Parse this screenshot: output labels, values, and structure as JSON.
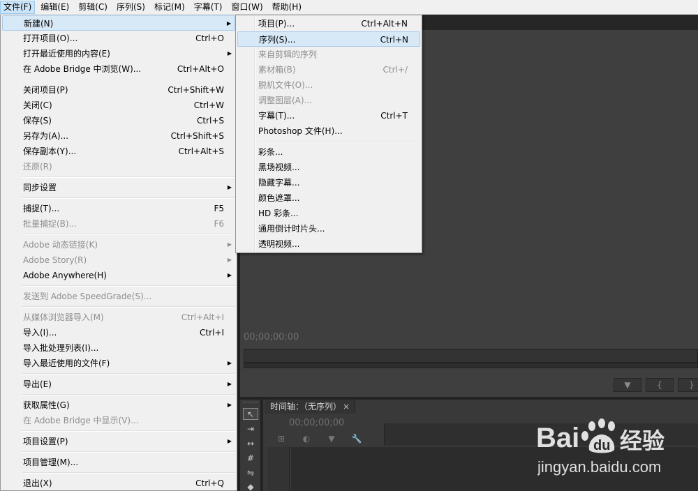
{
  "menubar": {
    "items": [
      "文件(F)",
      "编辑(E)",
      "剪辑(C)",
      "序列(S)",
      "标记(M)",
      "字幕(T)",
      "窗口(W)",
      "帮助(H)"
    ]
  },
  "file_menu": {
    "items": [
      {
        "label": "新建(N)",
        "shortcut": "",
        "submenu": true
      },
      {
        "label": "打开项目(O)...",
        "shortcut": "Ctrl+O"
      },
      {
        "label": "打开最近使用的内容(E)",
        "shortcut": "",
        "submenu": true
      },
      {
        "label": "在 Adobe Bridge 中浏览(W)...",
        "shortcut": "Ctrl+Alt+O"
      },
      {
        "label": "关闭项目(P)",
        "shortcut": "Ctrl+Shift+W"
      },
      {
        "label": "关闭(C)",
        "shortcut": "Ctrl+W"
      },
      {
        "label": "保存(S)",
        "shortcut": "Ctrl+S"
      },
      {
        "label": "另存为(A)...",
        "shortcut": "Ctrl+Shift+S"
      },
      {
        "label": "保存副本(Y)...",
        "shortcut": "Ctrl+Alt+S"
      },
      {
        "label": "还原(R)",
        "shortcut": "",
        "disabled": true
      },
      {
        "label": "同步设置",
        "shortcut": "",
        "submenu": true
      },
      {
        "label": "捕捉(T)...",
        "shortcut": "F5"
      },
      {
        "label": "批量捕捉(B)...",
        "shortcut": "F6",
        "disabled": true
      },
      {
        "label": "Adobe 动态链接(K)",
        "shortcut": "",
        "submenu": true,
        "disabled": true
      },
      {
        "label": "Adobe Story(R)",
        "shortcut": "",
        "submenu": true,
        "disabled": true
      },
      {
        "label": "Adobe Anywhere(H)",
        "shortcut": "",
        "submenu": true
      },
      {
        "label": "发送到 Adobe SpeedGrade(S)...",
        "shortcut": "",
        "disabled": true
      },
      {
        "label": "从媒体浏览器导入(M)",
        "shortcut": "Ctrl+Alt+I",
        "disabled": true
      },
      {
        "label": "导入(I)...",
        "shortcut": "Ctrl+I"
      },
      {
        "label": "导入批处理列表(I)...",
        "shortcut": ""
      },
      {
        "label": "导入最近使用的文件(F)",
        "shortcut": "",
        "submenu": true
      },
      {
        "label": "导出(E)",
        "shortcut": "",
        "submenu": true
      },
      {
        "label": "获取属性(G)",
        "shortcut": "",
        "submenu": true
      },
      {
        "label": "在 Adobe Bridge 中显示(V)...",
        "shortcut": "",
        "disabled": true
      },
      {
        "label": "项目设置(P)",
        "shortcut": "",
        "submenu": true
      },
      {
        "label": "项目管理(M)...",
        "shortcut": ""
      },
      {
        "label": "退出(X)",
        "shortcut": "Ctrl+Q"
      }
    ]
  },
  "new_submenu": {
    "items": [
      {
        "label": "项目(P)...",
        "shortcut": "Ctrl+Alt+N"
      },
      {
        "label": "序列(S)...",
        "shortcut": "Ctrl+N"
      },
      {
        "label": "来自剪辑的序列",
        "shortcut": "",
        "disabled": true
      },
      {
        "label": "素材箱(B)",
        "shortcut": "Ctrl+/",
        "disabled": true
      },
      {
        "label": "脱机文件(O)...",
        "shortcut": "",
        "disabled": true
      },
      {
        "label": "调整图层(A)...",
        "shortcut": "",
        "disabled": true
      },
      {
        "label": "字幕(T)...",
        "shortcut": "Ctrl+T"
      },
      {
        "label": "Photoshop 文件(H)...",
        "shortcut": ""
      },
      {
        "label": "彩条...",
        "shortcut": ""
      },
      {
        "label": "黑场视频...",
        "shortcut": ""
      },
      {
        "label": "隐藏字幕...",
        "shortcut": ""
      },
      {
        "label": "颜色遮罩...",
        "shortcut": ""
      },
      {
        "label": "HD 彩条...",
        "shortcut": ""
      },
      {
        "label": "通用倒计时片头...",
        "shortcut": ""
      },
      {
        "label": "透明视频...",
        "shortcut": ""
      }
    ]
  },
  "program_monitor": {
    "timecode": "00;00;00;00",
    "buttons": [
      "▼",
      "{",
      "}"
    ]
  },
  "timeline": {
    "tab_label": "时间轴：（无序列）",
    "tab_close": "×",
    "timecode": "00;00;00;00"
  },
  "watermark": {
    "logo_text": "Bai du 经验",
    "url": "jingyan.baidu.com"
  }
}
